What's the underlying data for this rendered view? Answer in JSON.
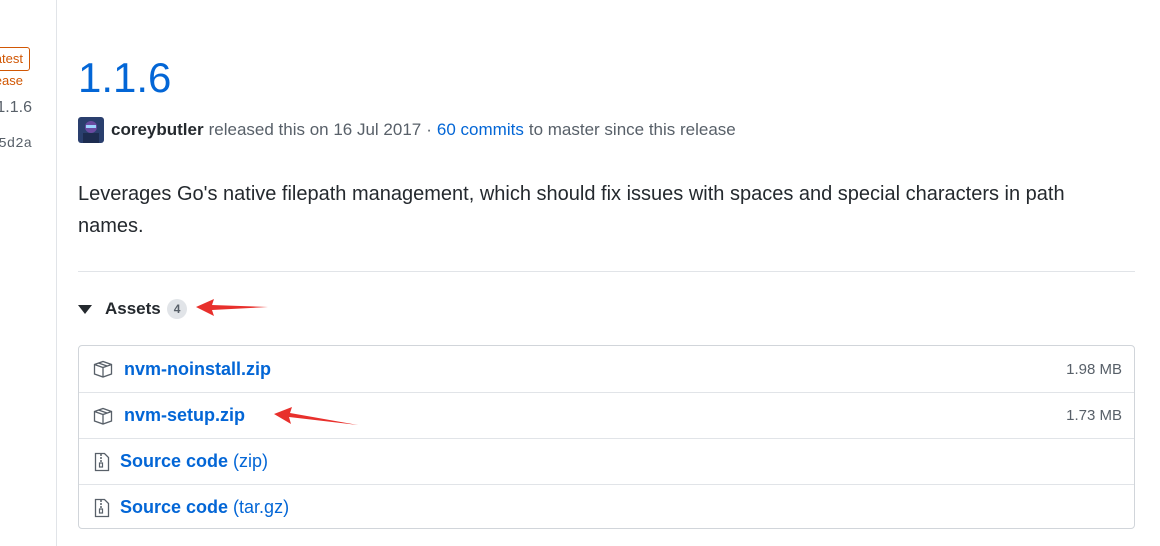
{
  "sidebar": {
    "latest_badge": "Latest release",
    "tag": "1.1.6",
    "commit_sha": "5d2a"
  },
  "release": {
    "title": "1.1.6",
    "author": "coreybutler",
    "released_text": "released this on 16 Jul 2017",
    "separator": "·",
    "commits_link": "60 commits",
    "commits_suffix": "to master since this release",
    "description": "Leverages Go's native filepath management, which should fix issues with spaces and special characters in path names."
  },
  "assets": {
    "label": "Assets",
    "count": "4",
    "items": [
      {
        "name": "nvm-noinstall.zip",
        "suffix": "",
        "size": "1.98 MB",
        "icon": "package-icon"
      },
      {
        "name": "nvm-setup.zip",
        "suffix": "",
        "size": "1.73 MB",
        "icon": "package-icon"
      },
      {
        "name": "Source code",
        "suffix": "(zip)",
        "size": "",
        "icon": "file-zip-icon"
      },
      {
        "name": "Source code",
        "suffix": "(tar.gz)",
        "size": "",
        "icon": "file-zip-icon"
      }
    ]
  },
  "colors": {
    "link": "#0366d6",
    "badge": "#d15704",
    "annotation_arrow": "#e8302c"
  }
}
